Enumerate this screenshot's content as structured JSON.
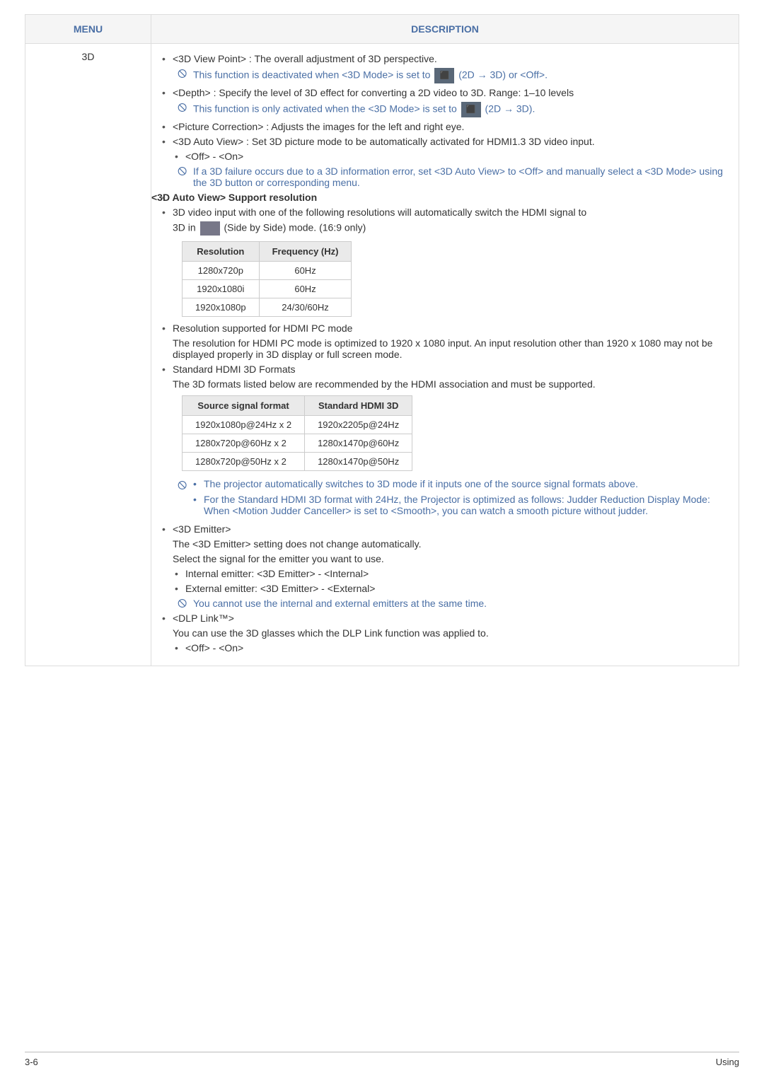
{
  "header": {
    "menu_col": "MENU",
    "desc_col": "DESCRIPTION"
  },
  "menu_item": "3D",
  "b1_viewpoint": "<3D View Point> : The overall adjustment of 3D perspective.",
  "n1_deact_viewpoint": "This function is deactivated when <3D Mode> is set to",
  "n1_deact_viewpoint_tail": "(2D → 3D) or <Off>.",
  "b2_depth": "<Depth> : Specify the level of 3D effect for converting a 2D video to 3D. Range: 1–10 levels",
  "n2_only_activated": "This function is only activated when the <3D Mode> is set to",
  "n2_only_activated_tail": "(2D → 3D).",
  "b3_picture_correction": "<Picture Correction> : Adjusts the images for the left and right eye.",
  "b4_auto_view": "<3D Auto View> : Set 3D picture mode to be automatically activated for HDMI1.3 3D video input.",
  "b4_sub_offon": "<Off> - <On>",
  "n3_failure": "If a 3D failure occurs due to a 3D information error, set <3D Auto View> to <Off> and manually select a <3D Mode> using the 3D button or corresponding menu.",
  "heading_support": "<3D Auto View> Support resolution",
  "b5_video_input": "3D video input with one of the following resolutions will automatically switch the HDMI signal to",
  "b5_line2_pre": "3D in",
  "b5_line2_post": "(Side by Side) mode. (16:9 only)",
  "resolution_table": {
    "header": {
      "res": "Resolution",
      "freq": "Frequency (Hz)"
    },
    "rows": [
      {
        "res": "1280x720p",
        "freq": "60Hz"
      },
      {
        "res": "1920x1080i",
        "freq": "60Hz"
      },
      {
        "res": "1920x1080p",
        "freq": "24/30/60Hz"
      }
    ]
  },
  "b6_hdmi_pc_head": "Resolution supported for HDMI PC mode",
  "b6_hdmi_pc_body": "The resolution for HDMI PC mode is optimized to 1920 x 1080 input. An input resolution other than 1920 x 1080 may not be displayed properly in 3D display or full screen mode.",
  "b7_std_head": "Standard HDMI 3D Formats",
  "b7_std_body": "The 3D formats listed below are recommended by the HDMI association and must be supported.",
  "format_table": {
    "header": {
      "src": "Source signal format",
      "std": "Standard HDMI 3D"
    },
    "rows": [
      {
        "src": "1920x1080p@24Hz x 2",
        "std": "1920x2205p@24Hz"
      },
      {
        "src": "1280x720p@60Hz x 2",
        "std": "1280x1470p@60Hz"
      },
      {
        "src": "1280x720p@50Hz x 2",
        "std": "1280x1470p@50Hz"
      }
    ]
  },
  "nb1": "The projector automatically switches to 3D mode if it inputs one of the source signal formats above.",
  "nb2": "For the Standard HDMI 3D format with 24Hz, the Projector is optimized as follows: Judder Reduction Display Mode: When <Motion Judder Canceller> is set to <Smooth>, you can watch a smooth picture without judder.",
  "b8_emitter": "<3D Emitter>",
  "b8_text1": "The <3D Emitter> setting does not change automatically.",
  "b8_text2": "Select the signal for the emitter you want to use.",
  "b8_sub1": "Internal emitter: <3D Emitter> - <Internal>",
  "b8_sub2": "External emitter: <3D Emitter> - <External>",
  "n4_sametime": "You cannot use the internal and external emitters at the same time.",
  "b9_dlp": "<DLP Link™>",
  "b9_text": " You can use the 3D glasses which the DLP Link function was applied to.",
  "b9_sub": "<Off> - <On>",
  "footer": {
    "page": "3-6",
    "section": "Using"
  }
}
